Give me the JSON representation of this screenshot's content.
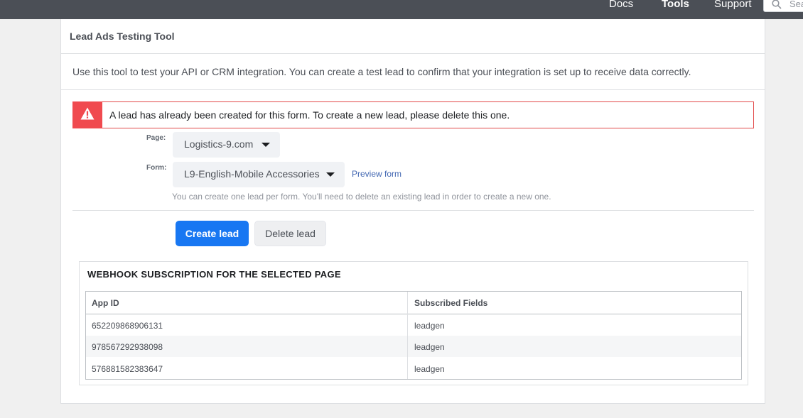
{
  "topnav": {
    "docs": "Docs",
    "tools": "Tools",
    "support": "Support",
    "search_placeholder": "Search"
  },
  "panel": {
    "title": "Lead Ads Testing Tool",
    "intro": "Use this tool to test your API or CRM integration. You can create a test lead to confirm that your integration is set up to receive data correctly."
  },
  "alert": {
    "icon": "warning-icon",
    "message": "A lead has already been created for this form. To create a new lead, please delete this one.",
    "color": "#f04a4f"
  },
  "form": {
    "page_label": "Page:",
    "page_value": "Logistics-9.com",
    "form_label": "Form:",
    "form_value": "L9-English-Mobile Accessories",
    "preview_link": "Preview form",
    "helper_text": "You can create one lead per form. You'll need to delete an existing lead in order to create a new one."
  },
  "actions": {
    "create_label": "Create lead",
    "delete_label": "Delete lead",
    "primary_color": "#1877f2"
  },
  "webhook": {
    "title": "WEBHOOK SUBSCRIPTION FOR THE SELECTED PAGE",
    "columns": [
      "App ID",
      "Subscribed Fields"
    ],
    "rows": [
      [
        "652209868906131",
        "leadgen"
      ],
      [
        "978567292938098",
        "leadgen"
      ],
      [
        "576881582383647",
        "leadgen"
      ]
    ]
  }
}
